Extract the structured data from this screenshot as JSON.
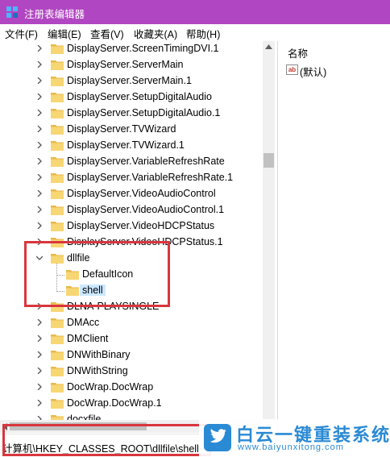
{
  "window": {
    "title": "注册表编辑器"
  },
  "menu": [
    "文件(F)",
    "编辑(E)",
    "查看(V)",
    "收藏夹(A)",
    "帮助(H)"
  ],
  "tree": [
    {
      "label": "DisplayServer.ScreenTimingDVI.1",
      "level": 1,
      "expander": "right"
    },
    {
      "label": "DisplayServer.ServerMain",
      "level": 1,
      "expander": "right"
    },
    {
      "label": "DisplayServer.ServerMain.1",
      "level": 1,
      "expander": "right"
    },
    {
      "label": "DisplayServer.SetupDigitalAudio",
      "level": 1,
      "expander": "right"
    },
    {
      "label": "DisplayServer.SetupDigitalAudio.1",
      "level": 1,
      "expander": "right"
    },
    {
      "label": "DisplayServer.TVWizard",
      "level": 1,
      "expander": "right"
    },
    {
      "label": "DisplayServer.TVWizard.1",
      "level": 1,
      "expander": "right"
    },
    {
      "label": "DisplayServer.VariableRefreshRate",
      "level": 1,
      "expander": "right"
    },
    {
      "label": "DisplayServer.VariableRefreshRate.1",
      "level": 1,
      "expander": "right"
    },
    {
      "label": "DisplayServer.VideoAudioControl",
      "level": 1,
      "expander": "right"
    },
    {
      "label": "DisplayServer.VideoAudioControl.1",
      "level": 1,
      "expander": "right"
    },
    {
      "label": "DisplayServer.VideoHDCPStatus",
      "level": 1,
      "expander": "right"
    },
    {
      "label": "DisplayServer.VideoHDCPStatus.1",
      "level": 1,
      "expander": "right"
    },
    {
      "label": "dllfile",
      "level": 1,
      "expander": "down"
    },
    {
      "label": "DefaultIcon",
      "level": 2,
      "expander": "none"
    },
    {
      "label": "shell",
      "level": 2,
      "expander": "none",
      "selected": true
    },
    {
      "label": "DLNA-PLAYSINGLE",
      "level": 1,
      "expander": "right"
    },
    {
      "label": "DMAcc",
      "level": 1,
      "expander": "right"
    },
    {
      "label": "DMClient",
      "level": 1,
      "expander": "right"
    },
    {
      "label": "DNWithBinary",
      "level": 1,
      "expander": "right"
    },
    {
      "label": "DNWithString",
      "level": 1,
      "expander": "right"
    },
    {
      "label": "DocWrap.DocWrap",
      "level": 1,
      "expander": "right"
    },
    {
      "label": "DocWrap.DocWrap.1",
      "level": 1,
      "expander": "right"
    },
    {
      "label": "docxfile",
      "level": 1,
      "expander": "right"
    }
  ],
  "right_pane": {
    "column_name": "名称",
    "values": [
      {
        "name": "(默认)",
        "icon": "ab-string-icon"
      }
    ]
  },
  "status_path": "计算机\\HKEY_CLASSES_ROOT\\dllfile\\shell",
  "watermark": {
    "brand": "白云一键重装系统",
    "url": "www.baiyunxitong.com",
    "icon": "twitter-bird-icon"
  },
  "colors": {
    "titlebar": "#b146c2",
    "folder": "#f7d674",
    "highlight_box": "#d9363e",
    "watermark": "#2a8ad4",
    "selection": "#cce8ff"
  }
}
